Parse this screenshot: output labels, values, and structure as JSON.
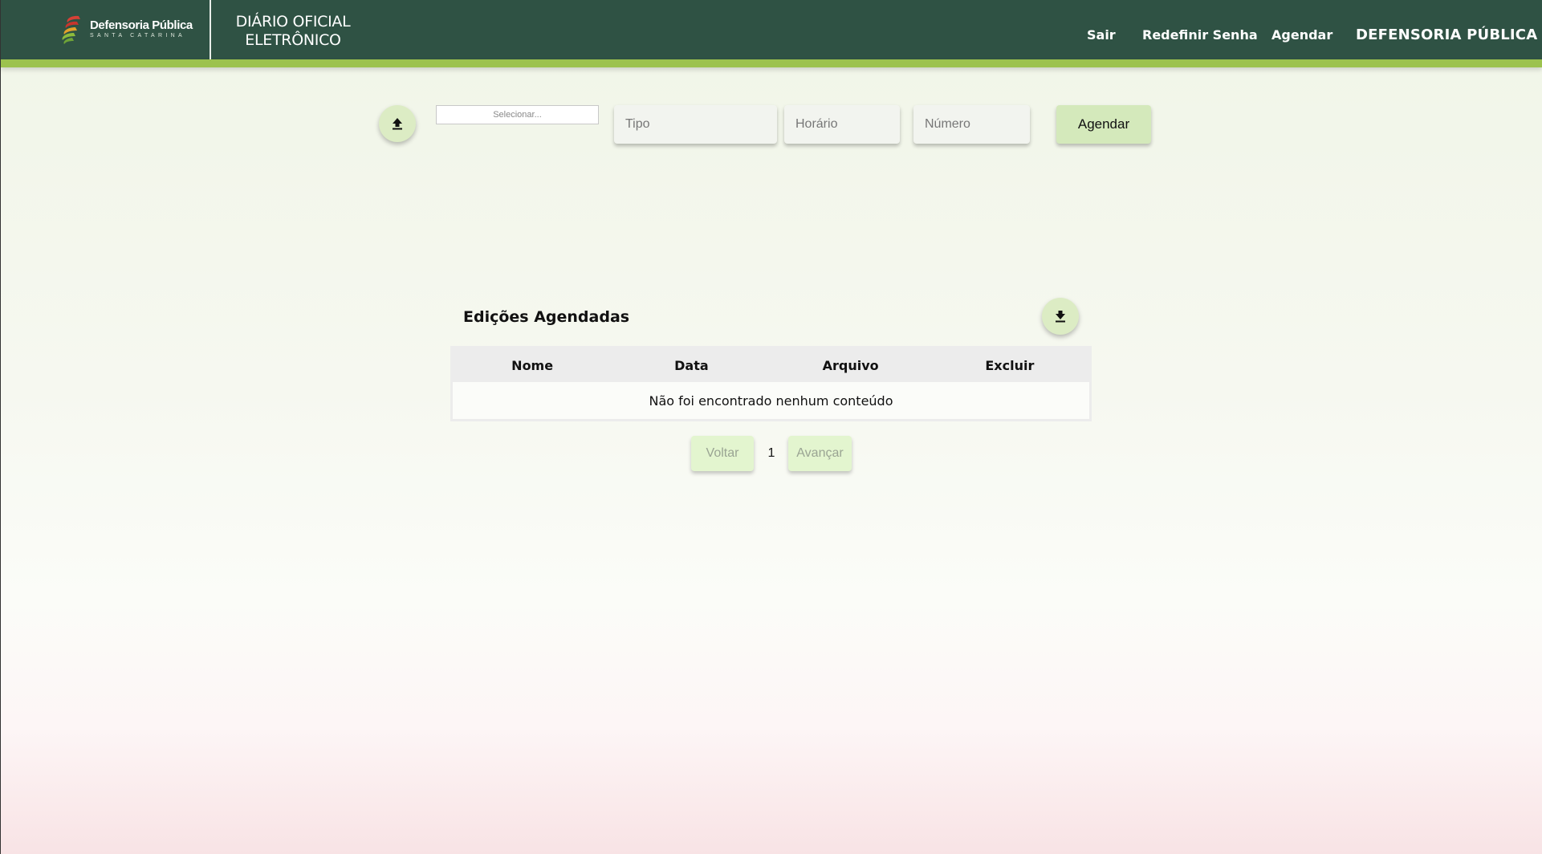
{
  "header": {
    "logo_name": "Defensoria Pública",
    "logo_sub": "SANTA CATARINA",
    "app_title_line1": "DIÁRIO OFICIAL",
    "app_title_line2": "ELETRÔNICO",
    "nav": {
      "sair": "Sair",
      "redefinir_senha": "Redefinir Senha",
      "agendar": "Agendar",
      "brand": "DEFENSORIA PÚBLICA"
    }
  },
  "form": {
    "file_select_label": "Selecionar...",
    "tipo_placeholder": "Tipo",
    "horario_placeholder": "Horário",
    "numero_placeholder": "Número",
    "submit_label": "Agendar"
  },
  "table": {
    "title": "Edições Agendadas",
    "columns": [
      "Nome",
      "Data",
      "Arquivo",
      "Excluir"
    ],
    "empty_message": "Não foi encontrado nenhum conteúdo"
  },
  "pagination": {
    "prev_label": "Voltar",
    "current_page": "1",
    "next_label": "Avançar"
  },
  "colors": {
    "header_bg": "#2f5244",
    "accent_stripe": "#9cc24e",
    "button_bg": "#d4e9bb"
  },
  "icons": {
    "upload": "upload-icon",
    "download": "download-icon"
  }
}
